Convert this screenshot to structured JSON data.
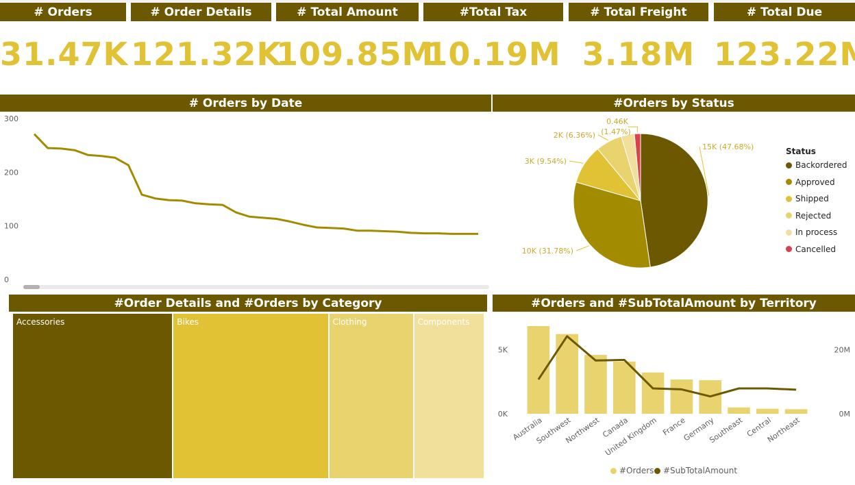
{
  "theme": {
    "dark": "#6b5800",
    "gold": "#e0c234",
    "olive": "#a38b00",
    "light": "#e8d36f",
    "pale": "#f0e09b",
    "red": "#d9414e"
  },
  "kpis": [
    {
      "title": "# Orders",
      "value": "31.47K"
    },
    {
      "title": "# Order Details",
      "value": "121.32K"
    },
    {
      "title": "# Total Amount",
      "value": "109.85M"
    },
    {
      "title": "#Total Tax",
      "value": "10.19M"
    },
    {
      "title": "# Total Freight",
      "value": "3.18M"
    },
    {
      "title": "# Total Due",
      "value": "123.22M"
    }
  ],
  "panels": {
    "orders_by_date": "# Orders by Date",
    "orders_by_status": "#Orders by Status",
    "by_category": "#Order Details and #Orders by Category",
    "by_territory": "#Orders and #SubTotalAmount by Territory"
  },
  "chart_data": [
    {
      "type": "line",
      "title": "# Orders by Date",
      "ylim": [
        0,
        300
      ],
      "yticks": [
        "0",
        "100",
        "200",
        "300"
      ],
      "series": [
        {
          "values": [
            271,
            245,
            244,
            241,
            232,
            230,
            227,
            213,
            158,
            151,
            148,
            147,
            142,
            140,
            139,
            125,
            117,
            115,
            113,
            108,
            102,
            97,
            96,
            95,
            91,
            91,
            90,
            89,
            87,
            86,
            86,
            85,
            85,
            85
          ]
        }
      ],
      "grid": false
    },
    {
      "type": "pie",
      "title": "#Orders by Status",
      "legend_title": "Status",
      "legend_position": "right",
      "legend": [
        "Backordered",
        "Approved",
        "Shipped",
        "Rejected",
        "In process",
        "Cancelled"
      ],
      "slices": [
        {
          "value": 47.68,
          "label": "15K (47.68%)",
          "color": "#6b5800"
        },
        {
          "value": 31.78,
          "label": "10K (31.78%)",
          "color": "#a38b00"
        },
        {
          "value": 9.54,
          "label": "3K (9.54%)",
          "color": "#e0c234"
        },
        {
          "value": 6.36,
          "label": "2K (6.36%)",
          "color": "#e8d36f"
        },
        {
          "value": 3.17,
          "label": "",
          "color": "#f0e09b"
        },
        {
          "value": 1.47,
          "label": "0.46K (1.47%)",
          "color": "#d9414e"
        }
      ],
      "slice_label_top": "0.46K",
      "slice_label_bottom": "(1.47%)"
    },
    {
      "type": "treemap",
      "title": "#Order Details and #Orders by Category",
      "categories": [
        "Accessories",
        "Bikes",
        "Clothing",
        "Components"
      ],
      "values": [
        34,
        33,
        18,
        15
      ],
      "colors": [
        "#6b5800",
        "#e0c234",
        "#e8d36f",
        "#f0e09b"
      ]
    },
    {
      "type": "bar",
      "title": "#Orders and #SubTotalAmount by Territory",
      "categories": [
        "Australia",
        "Southwest",
        "Northwest",
        "Canada",
        "United Kingdom",
        "France",
        "Germany",
        "Southeast",
        "Central",
        "Northeast"
      ],
      "series": [
        {
          "name": "#Orders",
          "type": "bar",
          "values": [
            6840,
            6220,
            4590,
            4070,
            3220,
            2670,
            2620,
            490,
            390,
            350
          ],
          "color": "#e8d36f"
        },
        {
          "name": "#SubTotalAmount",
          "type": "line",
          "values": [
            10.7,
            24.2,
            16.6,
            16.8,
            7.9,
            7.6,
            5.4,
            7.9,
            7.9,
            7.5
          ],
          "color": "#6b5800"
        }
      ],
      "y_left_ticks": [
        "0K",
        "5K"
      ],
      "y_right_ticks": [
        "0M",
        "20M"
      ],
      "ylim_left": [
        0,
        7000
      ],
      "ylim_right": [
        0,
        28
      ]
    }
  ]
}
